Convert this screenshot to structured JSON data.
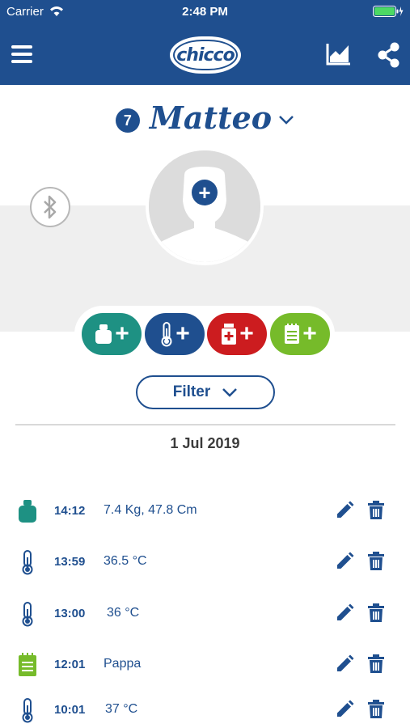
{
  "status_bar": {
    "carrier": "Carrier",
    "time": "2:48 PM"
  },
  "nav": {
    "logo_text": "chicco",
    "icons": [
      "menu-icon",
      "chart-icon",
      "share-icon"
    ]
  },
  "profile": {
    "age": "7",
    "name": "Matteo"
  },
  "actions": [
    {
      "type": "weight",
      "icon": "scale-plus-icon",
      "color": "#1e9183"
    },
    {
      "type": "temperature",
      "icon": "thermometer-plus-icon",
      "color": "#1f4f8f"
    },
    {
      "type": "medicine",
      "icon": "medicine-plus-icon",
      "color": "#cc1c1f"
    },
    {
      "type": "note",
      "icon": "notepad-plus-icon",
      "color": "#76bb2a"
    }
  ],
  "filter": {
    "label": "Filter"
  },
  "date_header": "1 Jul 2019",
  "records": [
    {
      "type": "weight",
      "time": "14:12",
      "value": "7.4 Kg, 47.8 Cm"
    },
    {
      "type": "temperature",
      "time": "13:59",
      "value": "36.5 °C"
    },
    {
      "type": "temperature",
      "time": "13:00",
      "value": "36 °C"
    },
    {
      "type": "note",
      "time": "12:01",
      "value": "Pappa"
    },
    {
      "type": "temperature",
      "time": "10:01",
      "value": "37 °C"
    }
  ],
  "colors": {
    "brand": "#1f4f8f",
    "weight": "#1e9183",
    "medicine": "#cc1c1f",
    "note": "#76bb2a"
  }
}
